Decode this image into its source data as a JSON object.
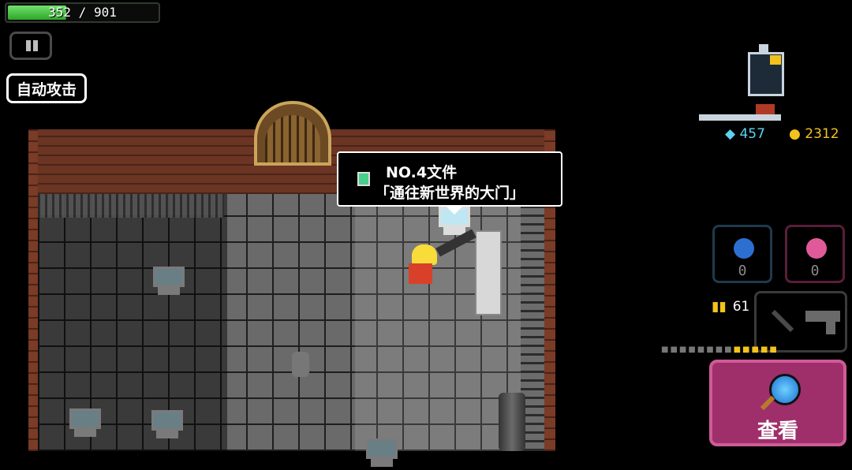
{
  "hud": {
    "hp_text": "352 / 901",
    "hp_fraction": 0.391,
    "auto_attack_label": "自动攻击"
  },
  "tooltip": {
    "title": "NO.4文件",
    "subtitle": "「通往新世界的大门」"
  },
  "currency": {
    "gems": "457",
    "gold": "2312"
  },
  "skills": [
    {
      "name": "lightning-skill",
      "count": "0",
      "color": "#2d6fd0"
    },
    {
      "name": "potion-skill",
      "count": "0",
      "color": "#e05a9a"
    }
  ],
  "weapon": {
    "ammo": "61"
  },
  "action": {
    "look_label": "查看"
  },
  "colors": {
    "hp": "#3fbf3a",
    "action_button": "#9e2f6a",
    "gem": "#5ed3f0",
    "gold": "#f3c21d"
  }
}
